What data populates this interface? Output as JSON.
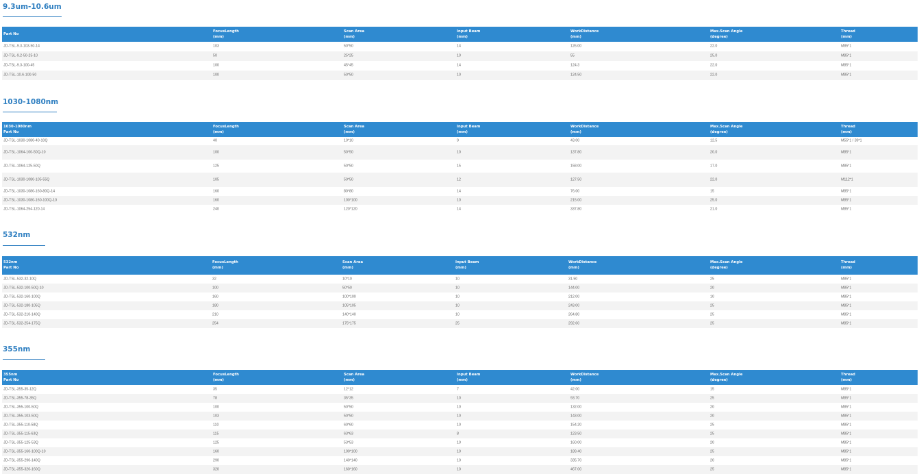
{
  "columns": {
    "part_no": "Part No",
    "focus_length": [
      "FocusLength",
      "(mm)"
    ],
    "scan_area": [
      "Scan Area",
      "(mm)"
    ],
    "input_beam": [
      "Input Beam",
      "(mm)"
    ],
    "work_distance": [
      "WorkDistance",
      "(mm)"
    ],
    "max_scan_angle": [
      "Max.Scan Angle",
      "(degree)"
    ],
    "thread": [
      "Thread",
      "(mm)"
    ]
  },
  "sections": [
    {
      "title": "9.3um-10.6um",
      "header_label": "",
      "rows": [
        [
          "JD-TSL-9.3-103-50-14",
          "103",
          "50*50",
          "14",
          "126.00",
          "22.0",
          "M85*1"
        ],
        [
          "JD-TSL-9.2-50-25-10",
          "50",
          "25*25",
          "10",
          "55",
          "25.0",
          "M85*1"
        ],
        [
          "JD-TSL-9.3-100-45",
          "100",
          "45*45",
          "14",
          "124.3",
          "22.0",
          "M85*1"
        ],
        [
          "JD-TSL-10.6-100-50",
          "100",
          "50*50",
          "10",
          "124.50",
          "22.0",
          "M85*1"
        ]
      ]
    },
    {
      "title": "1030-1080nm",
      "header_label": "1030-1080nm",
      "rows": [
        [
          "JD-TSL-1030-1080-40-10Q",
          "40",
          "10*10",
          "9",
          "43.00",
          "12.5",
          "M55*1 / 39*1"
        ],
        [
          "JD-TSL-1064-100-50Q-10",
          "100",
          "50*50",
          "10",
          "137.80",
          "20.0",
          "M85*1"
        ],
        [
          "JD-TSL-1064-125-50Q",
          "125",
          "50*50",
          "15",
          "158.00",
          "17.0",
          "M85*1"
        ],
        [
          "JD-TSL-1030-1080-105-55Q",
          "105",
          "50*50",
          "12",
          "127.50",
          "22.0",
          "M112*1"
        ],
        [
          "JD-TSL-1030-1080-160-80Q-14",
          "160",
          "80*80",
          "14",
          "76.00",
          "15",
          "M85*1"
        ],
        [
          "JD-TSL-1030-1080-160-100Q-10",
          "160",
          "100*100",
          "10",
          "215.00",
          "25.0",
          "M85*1"
        ],
        [
          "JD-TSL-1064-254-120-14",
          "240",
          "120*120",
          "14",
          "337.80",
          "21.0",
          "M85*1"
        ]
      ]
    },
    {
      "title": "532nm",
      "header_label": "532nm",
      "rows": [
        [
          "JD-TSL-532-32-10Q",
          "32",
          "10*10",
          "10",
          "31.50",
          "25",
          "M85*1"
        ],
        [
          "JD-TSL-532-100-50Q-10",
          "100",
          "50*50",
          "10",
          "144.00",
          "20",
          "M85*1"
        ],
        [
          "JD-TSL-532-160-100Q",
          "160",
          "100*100",
          "10",
          "212.00",
          "10",
          "M85*1"
        ],
        [
          "JD-TSL-532-180-105Q",
          "180",
          "105*105",
          "10",
          "243.00",
          "25",
          "M85*1"
        ],
        [
          "JD-TSL-532-210-140Q",
          "210",
          "140*140",
          "10",
          "264.80",
          "25",
          "M85*1"
        ],
        [
          "JD-TSL-532-254-175Q",
          "254",
          "175*175",
          "25",
          "292.60",
          "25",
          "M85*1"
        ]
      ]
    },
    {
      "title": "355nm",
      "header_label": "355nm",
      "rows": [
        [
          "JD-TSL-355-35-12Q",
          "35",
          "12*12",
          "7",
          "42.00",
          "15",
          "M85*1"
        ],
        [
          "JD-TSL-355-78-35Q",
          "78",
          "35*35",
          "10",
          "93.70",
          "25",
          "M85*1"
        ],
        [
          "JD-TSL-355-100-50Q",
          "100",
          "50*50",
          "10",
          "132.00",
          "20",
          "M85*1"
        ],
        [
          "JD-TSL-355-103-50Q",
          "103",
          "50*50",
          "10",
          "143.00",
          "20",
          "M85*1"
        ],
        [
          "JD-TSL-355-110-58Q",
          "110",
          "60*60",
          "10",
          "154.20",
          "25",
          "M85*1"
        ],
        [
          "JD-TSL-355-115-63Q",
          "115",
          "63*63",
          "8",
          "123.50",
          "25",
          "M85*1"
        ],
        [
          "JD-TSL-355-125-53Q",
          "125",
          "53*53",
          "10",
          "160.00",
          "20",
          "M85*1"
        ],
        [
          "JD-TSL-355-160-100Q-10",
          "160",
          "100*100",
          "10",
          "189.40",
          "25",
          "M85*1"
        ],
        [
          "JD-TSL-355-290-140Q",
          "290",
          "140*140",
          "10",
          "335.70",
          "20",
          "M85*1"
        ],
        [
          "JD-TSL-355-320-160Q",
          "320",
          "160*160",
          "10",
          "467.00",
          "25",
          "M85*1"
        ]
      ]
    }
  ]
}
